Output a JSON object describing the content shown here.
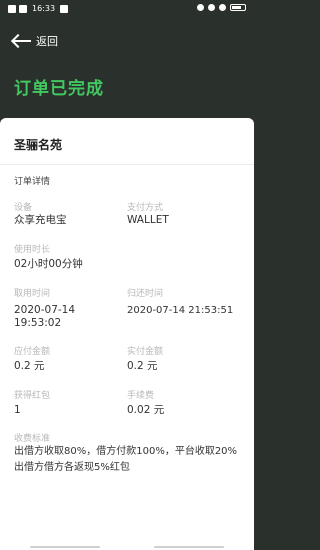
{
  "status_bar": {
    "time": "16:33"
  },
  "header": {
    "back_label": "返回",
    "title": "订单已完成"
  },
  "order": {
    "station_name": "圣骊名苑",
    "section_title": "订单详情",
    "fields": {
      "device": {
        "label": "设备",
        "value": "众享充电宝"
      },
      "payment": {
        "label": "支付方式",
        "value": "WALLET"
      },
      "duration": {
        "label": "使用时长",
        "value": "02小时00分钟"
      },
      "borrow_time": {
        "label": "取用时间",
        "value": "2020-07-14 19:53:02"
      },
      "return_time": {
        "label": "归还时间",
        "value": "2020-07-14 21:53:51"
      },
      "amount_due": {
        "label": "应付金额",
        "value": "0.2 元"
      },
      "amount_paid": {
        "label": "实付金额",
        "value": "0.2 元"
      },
      "red_packets": {
        "label": "获得红包",
        "value": "1"
      },
      "service_fee": {
        "label": "手续费",
        "value": "0.02 元"
      }
    },
    "fee_standard": {
      "label": "收费标准",
      "text": "出借方收取80%，借方付款100%，平台收取20%\n出借方借方各返现5%红包"
    }
  }
}
